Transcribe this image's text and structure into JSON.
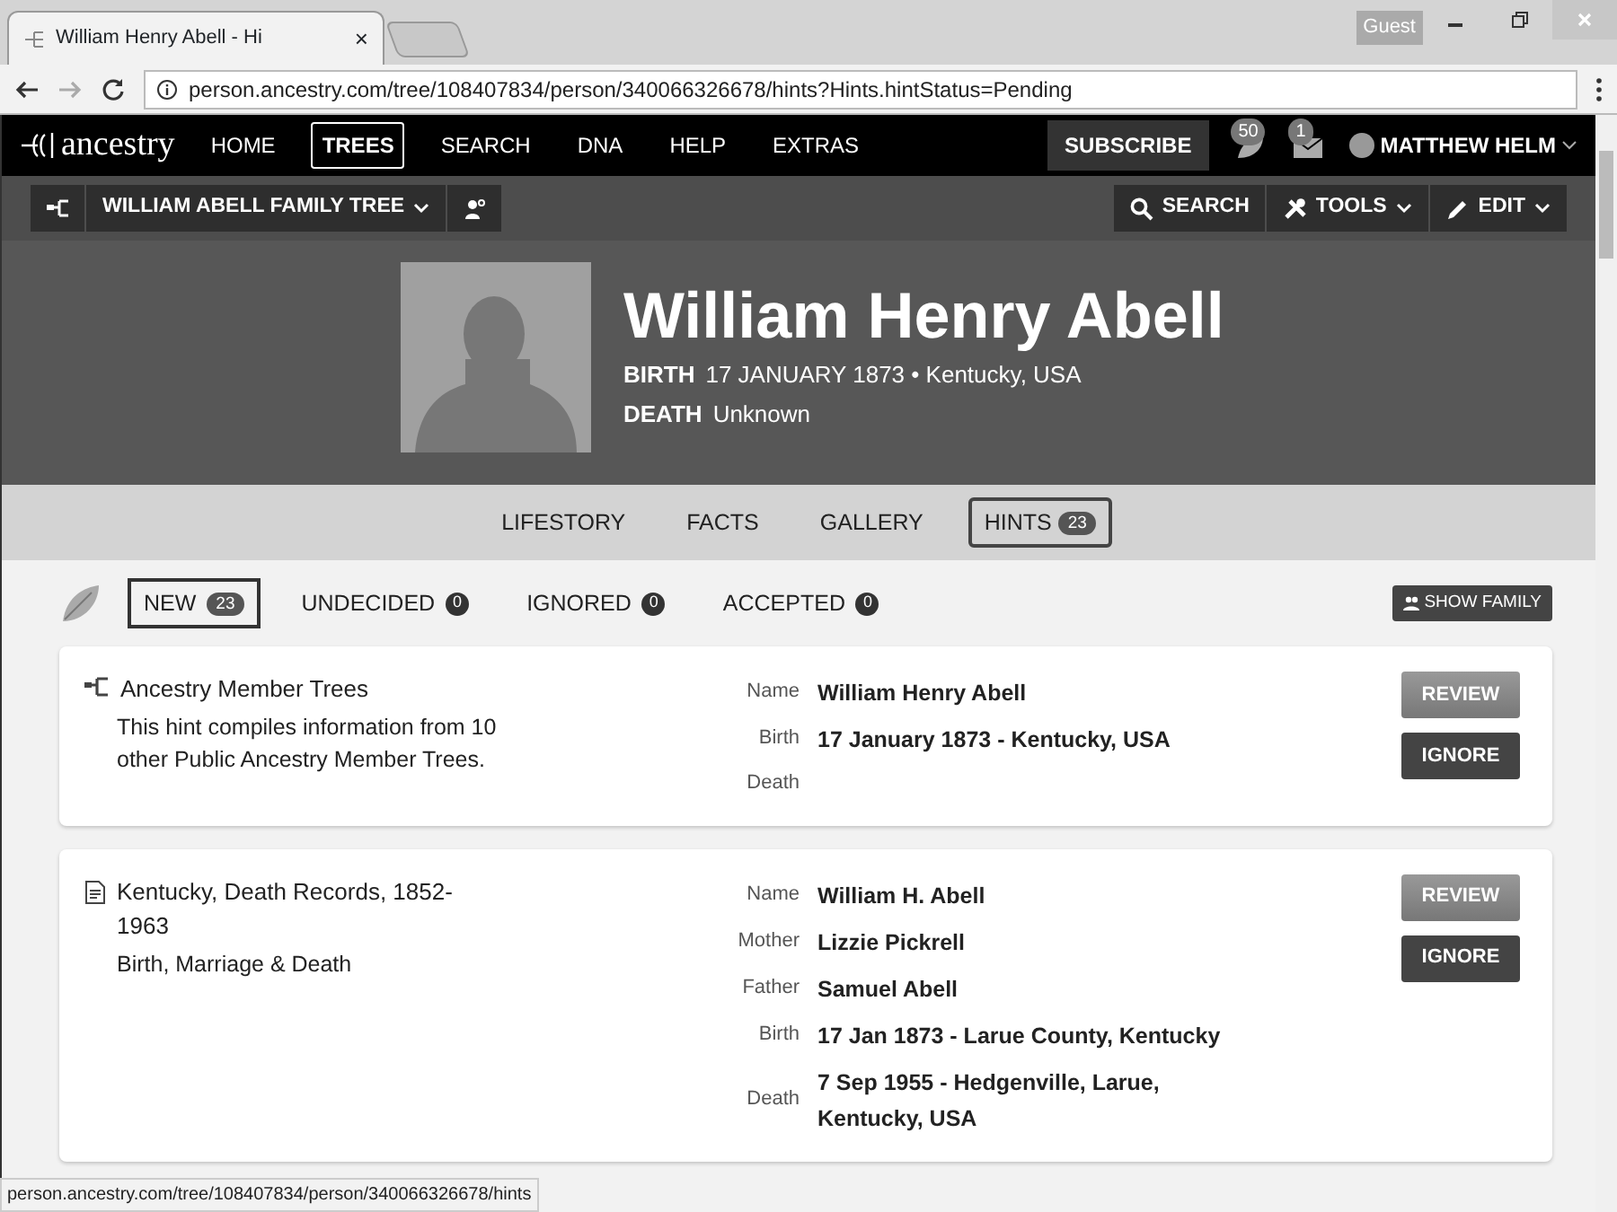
{
  "browser": {
    "tab_title": "William Henry Abell - Hi",
    "tab_close": "×",
    "profile": "Guest",
    "url": "person.ancestry.com/tree/108407834/person/340066326678/hints?Hints.hintStatus=Pending"
  },
  "site_nav": {
    "logo": "ancestry",
    "items": [
      {
        "label": "HOME",
        "selected": false
      },
      {
        "label": "TREES",
        "selected": true
      },
      {
        "label": "SEARCH",
        "selected": false
      },
      {
        "label": "DNA",
        "selected": false
      },
      {
        "label": "HELP",
        "selected": false
      },
      {
        "label": "EXTRAS",
        "selected": false
      }
    ],
    "subscribe": "SUBSCRIBE",
    "hints_count": "50",
    "messages_count": "1",
    "user": "MATTHEW HELM"
  },
  "tree_bar": {
    "tree_name": "WILLIAM ABELL FAMILY TREE",
    "actions": [
      {
        "label": "SEARCH",
        "kind": "search",
        "dropdown": false
      },
      {
        "label": "TOOLS",
        "kind": "tools",
        "dropdown": true
      },
      {
        "label": "EDIT",
        "kind": "edit",
        "dropdown": true
      }
    ]
  },
  "person": {
    "name": "William Henry Abell",
    "facts": [
      {
        "label": "BIRTH",
        "value": "17 JANUARY 1873 • Kentucky, USA"
      },
      {
        "label": "DEATH",
        "value": "Unknown"
      }
    ]
  },
  "person_tabs": [
    {
      "label": "LIFESTORY",
      "selected": false
    },
    {
      "label": "FACTS",
      "selected": false
    },
    {
      "label": "GALLERY",
      "selected": false
    },
    {
      "label": "HINTS",
      "count": "23",
      "selected": true
    }
  ],
  "hint_filters": [
    {
      "label": "NEW",
      "count": "23",
      "selected": true
    },
    {
      "label": "UNDECIDED",
      "count": "0",
      "selected": false
    },
    {
      "label": "IGNORED",
      "count": "0",
      "selected": false
    },
    {
      "label": "ACCEPTED",
      "count": "0",
      "selected": false
    }
  ],
  "show_family": "SHOW FAMILY",
  "hints": [
    {
      "kind": "tree",
      "source": "Ancestry Member Trees",
      "description": "This hint compiles information from 10 other Public Ancestry Member Trees.",
      "fields": [
        {
          "label": "Name",
          "value": "William Henry Abell"
        },
        {
          "label": "Birth",
          "value": "17 January 1873 - Kentucky, USA"
        },
        {
          "label": "Death"
        }
      ],
      "buttons": [
        {
          "label": "REVIEW",
          "kind": "primary"
        },
        {
          "label": "IGNORE",
          "kind": "secondary"
        }
      ]
    },
    {
      "kind": "record",
      "source": "Kentucky, Death Records, 1852-1963",
      "description": "Birth, Marriage & Death",
      "fields": [
        {
          "label": "Name",
          "value": "William H. Abell"
        },
        {
          "label": "Mother",
          "value": "Lizzie Pickrell"
        },
        {
          "label": "Father",
          "value": "Samuel Abell"
        },
        {
          "label": "Birth",
          "value": "17 Jan 1873 - Larue County, Kentucky"
        },
        {
          "label": "Death",
          "value": "7 Sep 1955 - Hedgenville, Larue, Kentucky, USA"
        }
      ],
      "buttons": [
        {
          "label": "REVIEW",
          "kind": "primary"
        },
        {
          "label": "IGNORE",
          "kind": "secondary"
        }
      ]
    }
  ],
  "status_bar": "person.ancestry.com/tree/108407834/person/340066326678/hints"
}
